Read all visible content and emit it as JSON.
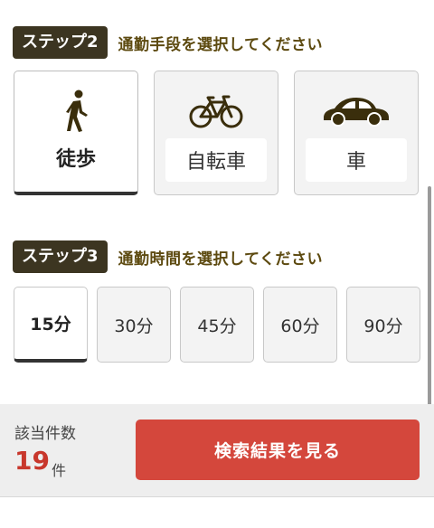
{
  "step2": {
    "badge": "ステップ2",
    "title": "通勤手段を選択してください",
    "options": [
      {
        "label": "徒歩",
        "icon": "walking-person-icon",
        "selected": true
      },
      {
        "label": "自転車",
        "icon": "bicycle-icon",
        "selected": false
      },
      {
        "label": "車",
        "icon": "car-icon",
        "selected": false
      }
    ]
  },
  "step3": {
    "badge": "ステップ3",
    "title": "通勤時間を選択してください",
    "options": [
      {
        "label": "15分",
        "selected": true
      },
      {
        "label": "30分",
        "selected": false
      },
      {
        "label": "45分",
        "selected": false
      },
      {
        "label": "60分",
        "selected": false
      },
      {
        "label": "90分",
        "selected": false
      }
    ]
  },
  "footer": {
    "count_label": "該当件数",
    "count_value": "19",
    "count_unit": "件",
    "cta_label": "検索結果を見る"
  },
  "colors": {
    "badge_bg": "#3c3521",
    "heading_text": "#5d4a10",
    "icon": "#3a2e0c",
    "accent_red": "#d4473c",
    "count_red": "#c8372c"
  }
}
